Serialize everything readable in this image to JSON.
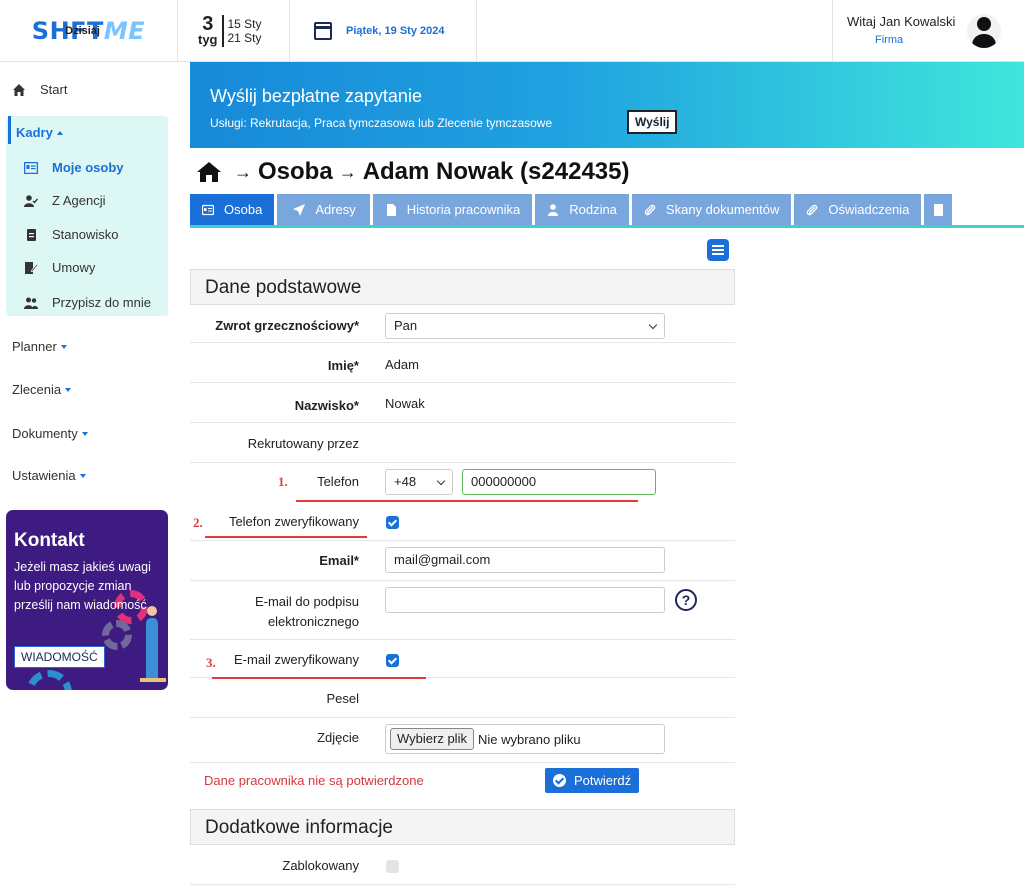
{
  "header": {
    "logo_main": "SHFT",
    "logo_accent": "ME",
    "week_number": "3",
    "week_label": "tyg",
    "week_start": "15 Sty",
    "week_end": "21 Sty",
    "today_label": "Dzisiaj",
    "today_date": "Piątek, 19 Sty 2024",
    "greeting": "Witaj Jan Kowalski",
    "company": "Firma"
  },
  "sidebar": {
    "start": "Start",
    "kadry": "Kadry",
    "kadry_items": [
      "Moje osoby",
      "Z Agencji",
      "Stanowisko",
      "Umowy",
      "Przypisz do mnie"
    ],
    "planner": "Planner",
    "zlecenia": "Zlecenia",
    "dokumenty": "Dokumenty",
    "ustawienia": "Ustawienia"
  },
  "contact": {
    "title": "Kontakt",
    "text": "Jeżeli masz jakieś uwagi lub propozycje zmian prześlij nam wiadomość",
    "button": "WIADOMOŚĆ"
  },
  "banner": {
    "title": "Wyślij bezpłatne zapytanie",
    "subtitle": "Usługi: Rekrutacja, Praca tymczasowa lub Zlecenie tymczasowe",
    "button": "Wyślij"
  },
  "breadcrumb": {
    "part1": "Osoba",
    "part2": "Adam Nowak (s242435)"
  },
  "tabs": [
    "Osoba",
    "Adresy",
    "Historia pracownika",
    "Rodzina",
    "Skany dokumentów",
    "Oświadczenia"
  ],
  "sections": {
    "basic": "Dane podstawowe",
    "additional": "Dodatkowe informacje"
  },
  "form": {
    "salutation_label": "Zwrot grzecznościowy*",
    "salutation_value": "Pan",
    "first_name_label": "Imię*",
    "first_name_value": "Adam",
    "last_name_label": "Nazwisko*",
    "last_name_value": "Nowak",
    "recruited_label": "Rekrutowany przez",
    "phone_label": "Telefon",
    "phone_prefix": "+48",
    "phone_value": "000000000",
    "phone_verified_label": "Telefon zweryfikowany",
    "email_label": "Email*",
    "email_value": "mail@gmail.com",
    "esign_email_label_1": "E-mail do podpisu",
    "esign_email_label_2": "elektronicznego",
    "help_symbol": "?",
    "email_verified_label": "E-mail zweryfikowany",
    "pesel_label": "Pesel",
    "photo_label": "Zdjęcie",
    "file_button": "Wybierz plik",
    "file_status": "Nie wybrano pliku",
    "warning": "Dane pracownika nie są potwierdzone",
    "confirm_button": "Potwierdź",
    "blocked_label": "Zablokowany"
  },
  "annotations": {
    "n1": "1.",
    "n2": "2.",
    "n3": "3."
  },
  "colors": {
    "primary": "#1b6fd8",
    "tab_inactive": "#7aa6de",
    "annotation_red": "#e23b3b",
    "contact_bg": "#3e1b80",
    "kadry_bg": "#ddf7f4"
  }
}
